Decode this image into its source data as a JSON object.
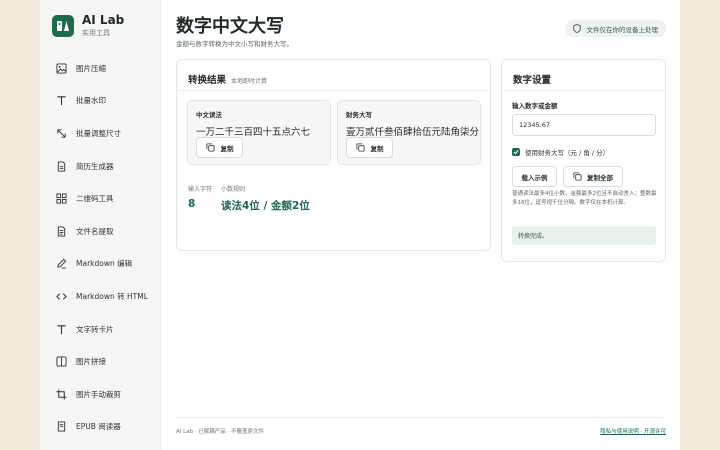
{
  "brand": {
    "name": "AI Lab",
    "subtitle": "实用工具"
  },
  "sidebar": {
    "items": [
      {
        "label": "图片压缩",
        "icon": "image-icon"
      },
      {
        "label": "批量水印",
        "icon": "text-icon"
      },
      {
        "label": "批量调整尺寸",
        "icon": "resize-icon"
      },
      {
        "label": "简历生成器",
        "icon": "document-icon"
      },
      {
        "label": "二维码工具",
        "icon": "grid-icon"
      },
      {
        "label": "文件名提取",
        "icon": "file-icon"
      },
      {
        "label": "Markdown 编辑",
        "icon": "pen-icon"
      },
      {
        "label": "Markdown 转 HTML",
        "icon": "code-icon"
      },
      {
        "label": "文字转卡片",
        "icon": "text-icon"
      },
      {
        "label": "图片拼接",
        "icon": "image-icon"
      },
      {
        "label": "图片手动裁剪",
        "icon": "crop-icon"
      },
      {
        "label": "EPUB 阅读器",
        "icon": "book-icon"
      }
    ]
  },
  "header": {
    "title": "数字中文大写",
    "subtitle": "金额与数字转换为中文小写和财务大写。",
    "privacy_badge": "文件仅在你的设备上处理"
  },
  "result": {
    "title": "转换结果",
    "note": "本地即时计算",
    "chinese": {
      "label": "中文读法",
      "value": "一万二千三百四十五点六七",
      "copy_label": "复制"
    },
    "finance": {
      "label": "财务大写",
      "value": "壹万贰仟叁佰肆拾伍元陆角柒分",
      "copy_label": "复制"
    },
    "stats": {
      "input_chars_label": "输入字符",
      "input_chars_value": "8",
      "decimal_rule_label": "小数规则",
      "decimal_rule_value": "读法4位 / 金额2位"
    }
  },
  "settings": {
    "title": "数字设置",
    "input_label": "输入数字或金额",
    "input_value": "12345.67",
    "checkbox_label": "使用财务大写（元 / 角 / 分）",
    "checkbox_checked": true,
    "sample_button": "载入示例",
    "copy_all_button": "复制全部",
    "hint": "普通读法最多4位小数，金额最多2位且不自动舍入；整数最多16位，逗号视千位分隔。数字仅在本机计算。",
    "status": "转换完成。"
  },
  "footer": {
    "left": "AI Lab · 已解耦产品 · 不覆盖原文件",
    "right": "隐私与使用说明 · 开源许可"
  },
  "colors": {
    "accent": "#1d6b4b",
    "background": "#f3ede0",
    "status_bg": "#e9f1eb"
  }
}
